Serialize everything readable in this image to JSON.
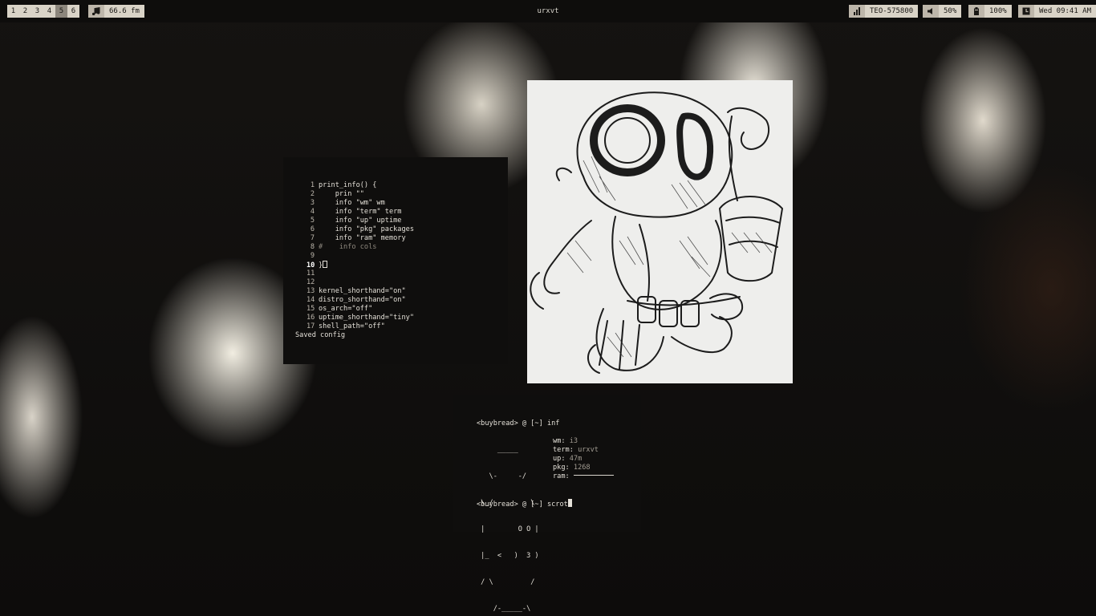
{
  "topbar": {
    "workspaces": [
      "1",
      "2",
      "3",
      "4",
      "5",
      "6"
    ],
    "active_workspace": "5",
    "music": {
      "icon": "music-note-icon",
      "text": "66.6 fm"
    },
    "window_title": "urxvt",
    "network": {
      "icon": "signal-bars-icon",
      "text": "TEO-575800"
    },
    "volume": {
      "icon": "speaker-icon",
      "text": "50%"
    },
    "battery": {
      "icon": "battery-icon",
      "text": "100%"
    },
    "clock": {
      "icon": "clock-icon",
      "text": "Wed 09:41 AM"
    }
  },
  "editor": {
    "lines": [
      {
        "num": "1",
        "text": "print_info() {"
      },
      {
        "num": "2",
        "text": "    prin \"\""
      },
      {
        "num": "3",
        "text": "    info \"wm\" wm"
      },
      {
        "num": "4",
        "text": "    info \"term\" term"
      },
      {
        "num": "5",
        "text": "    info \"up\" uptime"
      },
      {
        "num": "6",
        "text": "    info \"pkg\" packages"
      },
      {
        "num": "7",
        "text": "    info \"ram\" memory"
      },
      {
        "num": "8",
        "text": "#    info cols"
      },
      {
        "num": "9",
        "text": ""
      },
      {
        "num": "10",
        "text": "}"
      },
      {
        "num": "11",
        "text": ""
      },
      {
        "num": "12",
        "text": ""
      },
      {
        "num": "13",
        "text": "kernel_shorthand=\"on\""
      },
      {
        "num": "14",
        "text": "distro_shorthand=\"on\""
      },
      {
        "num": "15",
        "text": "os_arch=\"off\""
      },
      {
        "num": "16",
        "text": "uptime_shorthand=\"tiny\""
      },
      {
        "num": "17",
        "text": "shell_path=\"off\""
      }
    ],
    "status": "Saved config"
  },
  "image": {
    "alt": ""
  },
  "fetch": {
    "prompt1": "<buybread> @ [~] inf",
    "art": [
      "     _____",
      "   \\-     -/",
      " \\_/         \\",
      " |        O O |",
      " |_  <   )  3 )",
      " / \\         /",
      "    /-_____-\\"
    ],
    "info": [
      {
        "key": "wm",
        "value": "i3"
      },
      {
        "key": "term",
        "value": "urxvt"
      },
      {
        "key": "up",
        "value": "47m"
      },
      {
        "key": "pkg",
        "value": "1268"
      },
      {
        "key": "ram",
        "value": ""
      }
    ],
    "prompt2": "<buybread> @ [~] scrot"
  }
}
